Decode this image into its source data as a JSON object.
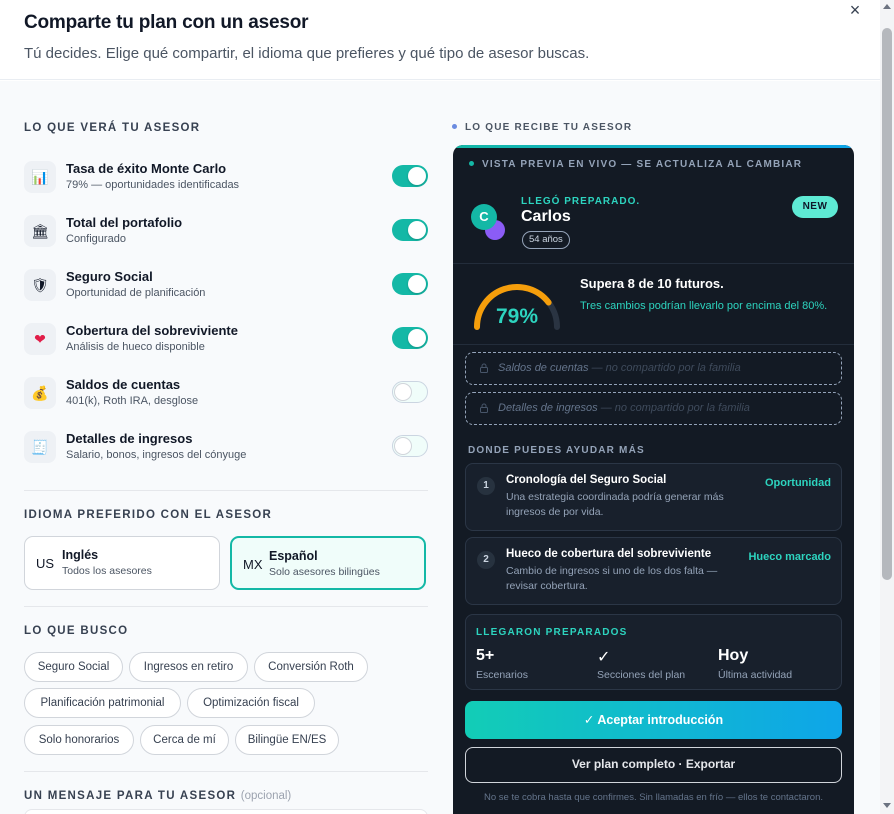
{
  "header": {
    "title": "Comparte tu plan con un asesor",
    "subtitle": "Tú decides. Elige qué compartir, el idioma que prefieres y qué tipo de asesor buscas.",
    "close_label": "×"
  },
  "share": {
    "section_label": "LO QUE VERÁ TU ASESOR",
    "items": [
      {
        "icon": "chart-icon",
        "glyph": "📊",
        "title": "Tasa de éxito Monte Carlo",
        "desc": "79% — oportunidades identificadas",
        "enabled": true
      },
      {
        "icon": "bank-icon",
        "glyph": "🏛",
        "title": "Total del portafolio",
        "desc": "Configurado",
        "enabled": true
      },
      {
        "icon": "shield-icon",
        "glyph": "🛡",
        "title": "Seguro Social",
        "desc": "Oportunidad de planificación",
        "enabled": true
      },
      {
        "icon": "heart-icon",
        "glyph": "❤",
        "title": "Cobertura del sobreviviente",
        "desc": "Análisis de hueco disponible",
        "enabled": true
      },
      {
        "icon": "money-bag-icon",
        "glyph": "💰",
        "title": "Saldos de cuentas",
        "desc": "401(k), Roth IRA, desglose",
        "enabled": false
      },
      {
        "icon": "receipt-icon",
        "glyph": "🧾",
        "title": "Detalles de ingresos",
        "desc": "Salario, bonos, ingresos del cónyuge",
        "enabled": false
      }
    ]
  },
  "language": {
    "section_label": "IDIOMA PREFERIDO CON EL ASESOR",
    "options": [
      {
        "code": "US",
        "name": "Inglés",
        "desc": "Todos los asesores",
        "selected": false
      },
      {
        "code": "MX",
        "name": "Español",
        "desc": "Solo asesores bilingües",
        "selected": true
      }
    ]
  },
  "seeking": {
    "section_label": "LO QUE BUSCO",
    "chips": [
      "Seguro Social",
      "Ingresos en retiro",
      "Conversión Roth",
      "Planificación patrimonial",
      "Optimización fiscal",
      "Solo honorarios",
      "Cerca de mí",
      "Bilingüe EN/ES"
    ]
  },
  "message": {
    "section_label": "UN MENSAJE PARA TU ASESOR",
    "optional_label": "(opcional)"
  },
  "preview": {
    "section_label": "LO QUE RECIBE TU ASESOR",
    "live_label": "VISTA PREVIA EN VIVO — SE ACTUALIZA AL CAMBIAR",
    "arrived_label": "LLEGÓ PREPARADO.",
    "client_initial": "C",
    "client_name": "Carlos",
    "age": "54 años",
    "badge": "NEW",
    "success_pct": "79%",
    "success_fraction": 0.79,
    "beats": "Supera 8 de 10 futuros.",
    "beats_sub": "Tres cambios podrían llevarlo por encima del 80%.",
    "locked": [
      {
        "label": "Saldos de cuentas",
        "note": " — no compartido por la familia"
      },
      {
        "label": "Detalles de ingresos",
        "note": " — no compartido por la familia"
      }
    ],
    "help_label": "DONDE PUEDES AYUDAR MÁS",
    "help_items": [
      {
        "num": "1",
        "title": "Cronología del Seguro Social",
        "desc": "Una estrategia coordinada podría generar más ingresos de por vida.",
        "tag": "Oportunidad"
      },
      {
        "num": "2",
        "title": "Hueco de cobertura del sobreviviente",
        "desc": "Cambio de ingresos si uno de los dos falta — revisar cobertura.",
        "tag": "Hueco marcado"
      }
    ],
    "stats_label": "LLEGARON PREPARADOS",
    "stats": [
      {
        "value": "5+",
        "label": "Escenarios"
      },
      {
        "value": "✓",
        "label": "Secciones del plan"
      },
      {
        "value": "Hoy",
        "label": "Última actividad"
      }
    ],
    "accept_label": "✓ Aceptar introducción",
    "view_label": "Ver plan completo · Exportar",
    "footnote": "No se te cobra hasta que confirmes. Sin llamadas en frío — ellos te contactaron."
  },
  "colors": {
    "accent": "#14b8a6",
    "card_bg": "#131a24",
    "gauge": "#f59e0b"
  }
}
